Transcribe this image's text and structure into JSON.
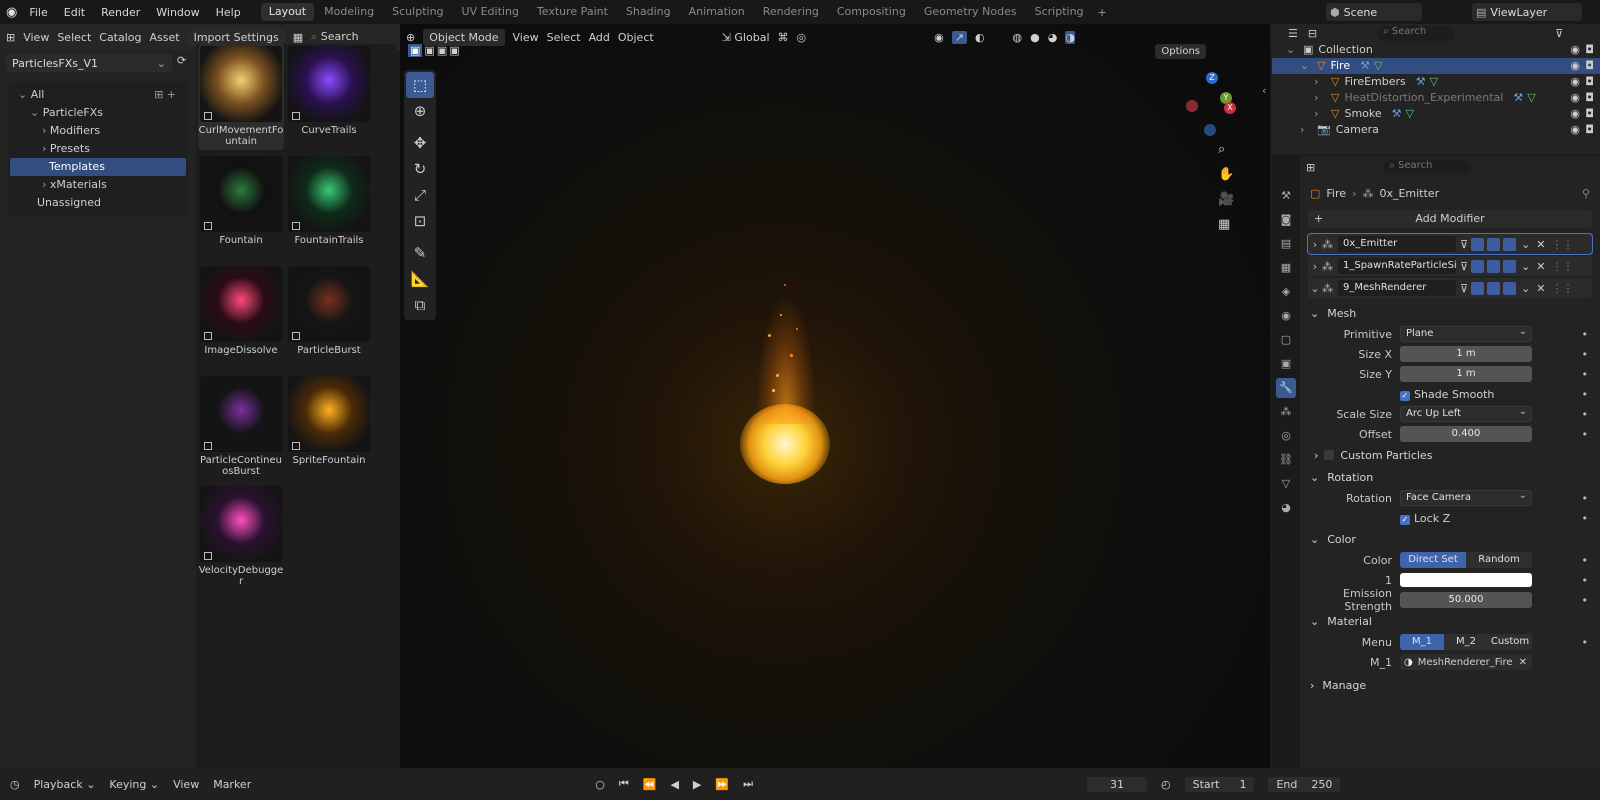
{
  "menu": [
    "File",
    "Edit",
    "Render",
    "Window",
    "Help"
  ],
  "workspaces": [
    "Layout",
    "Modeling",
    "Sculpting",
    "UV Editing",
    "Texture Paint",
    "Shading",
    "Animation",
    "Rendering",
    "Compositing",
    "Geometry Nodes",
    "Scripting"
  ],
  "scene": "Scene",
  "view_layer": "ViewLayer",
  "asset_header": {
    "view": "View",
    "select": "Select",
    "catalog": "Catalog",
    "asset": "Asset",
    "import": "Import Settings",
    "search": "Search"
  },
  "library": "ParticlesFXs_V1",
  "catalog_tree": [
    {
      "label": "All",
      "indent": 0
    },
    {
      "label": "ParticleFXs",
      "indent": 1
    },
    {
      "label": "Modifiers",
      "indent": 2
    },
    {
      "label": "Presets",
      "indent": 2
    },
    {
      "label": "Templates",
      "indent": 2,
      "selected": true
    },
    {
      "label": "xMaterials",
      "indent": 2
    },
    {
      "label": "Unassigned",
      "indent": 1
    }
  ],
  "assets": [
    {
      "label": "CurlMovementFountain",
      "c1": "#f4d070",
      "c2": "#7a5020"
    },
    {
      "label": "CurveTrails",
      "c1": "#8a4cff",
      "c2": "#2a1050"
    },
    {
      "label": "Fountain",
      "c1": "#2c7a3c",
      "c2": "#111"
    },
    {
      "label": "FountainTrails",
      "c1": "#38c878",
      "c2": "#0e2a18"
    },
    {
      "label": "ImageDissolve",
      "c1": "#ff4a7a",
      "c2": "#2a0c16"
    },
    {
      "label": "ParticleBurst",
      "c1": "#7a3020",
      "c2": "#151515"
    },
    {
      "label": "ParticleContineuosBurst",
      "c1": "#7a30a0",
      "c2": "#141414"
    },
    {
      "label": "SpriteFountain",
      "c1": "#ffb020",
      "c2": "#4a2a08"
    },
    {
      "label": "VelocityDebugger",
      "c1": "#ff50c0",
      "c2": "#2a1230"
    }
  ],
  "viewport_header": {
    "mode": "Object Mode",
    "view": "View",
    "select": "Select",
    "add": "Add",
    "object": "Object",
    "transform": "Global",
    "options": "Options"
  },
  "outliner": {
    "search": "Search",
    "rows": [
      {
        "label": "Collection",
        "indent": 0,
        "icon": "collection-icon"
      },
      {
        "label": "Fire",
        "indent": 1,
        "icon": "object-icon",
        "selected": true
      },
      {
        "label": "FireEmbers",
        "indent": 2,
        "icon": "object-icon"
      },
      {
        "label": "HeatDistortion_Experimental",
        "indent": 2,
        "icon": "object-icon",
        "dim": true
      },
      {
        "label": "Smoke",
        "indent": 2,
        "icon": "object-icon"
      },
      {
        "label": "Camera",
        "indent": 1,
        "icon": "camera-icon"
      }
    ]
  },
  "properties": {
    "search": "Search",
    "breadcrumb": [
      "Fire",
      "0x_Emitter"
    ],
    "add_modifier": "Add Modifier",
    "modifiers": [
      "0x_Emitter",
      "1_SpawnRateParticleSi...",
      "9_MeshRenderer"
    ],
    "sections": {
      "mesh": "Mesh",
      "rotation": "Rotation",
      "color": "Color",
      "material": "Material",
      "manage": "Manage",
      "custom_particles": "Custom Particles"
    },
    "primitive_label": "Primitive",
    "primitive": "Plane",
    "size_x_label": "Size X",
    "size_x": "1 m",
    "size_y_label": "Size Y",
    "size_y": "1 m",
    "shade_smooth": "Shade Smooth",
    "scale_size_label": "Scale Size",
    "scale_size": "Arc Up Left",
    "offset_label": "Offset",
    "offset": "0.400",
    "rotation_label": "Rotation",
    "rotation": "Face Camera",
    "lock_z": "Lock Z",
    "color_label": "Color",
    "color_direct": "Direct Set",
    "color_random": "Random",
    "color_1_label": "1",
    "emission_label": "Emission Strength",
    "emission": "50.000",
    "menu_label": "Menu",
    "menu_m1": "M_1",
    "menu_m2": "M_2",
    "menu_custom": "Custom",
    "m1_label": "M_1",
    "m1_value": "MeshRenderer_Fire"
  },
  "timeline": {
    "playback": "Playback",
    "keying": "Keying",
    "view": "View",
    "marker": "Marker",
    "frame": "31",
    "start_label": "Start",
    "start": "1",
    "end_label": "End",
    "end": "250"
  }
}
